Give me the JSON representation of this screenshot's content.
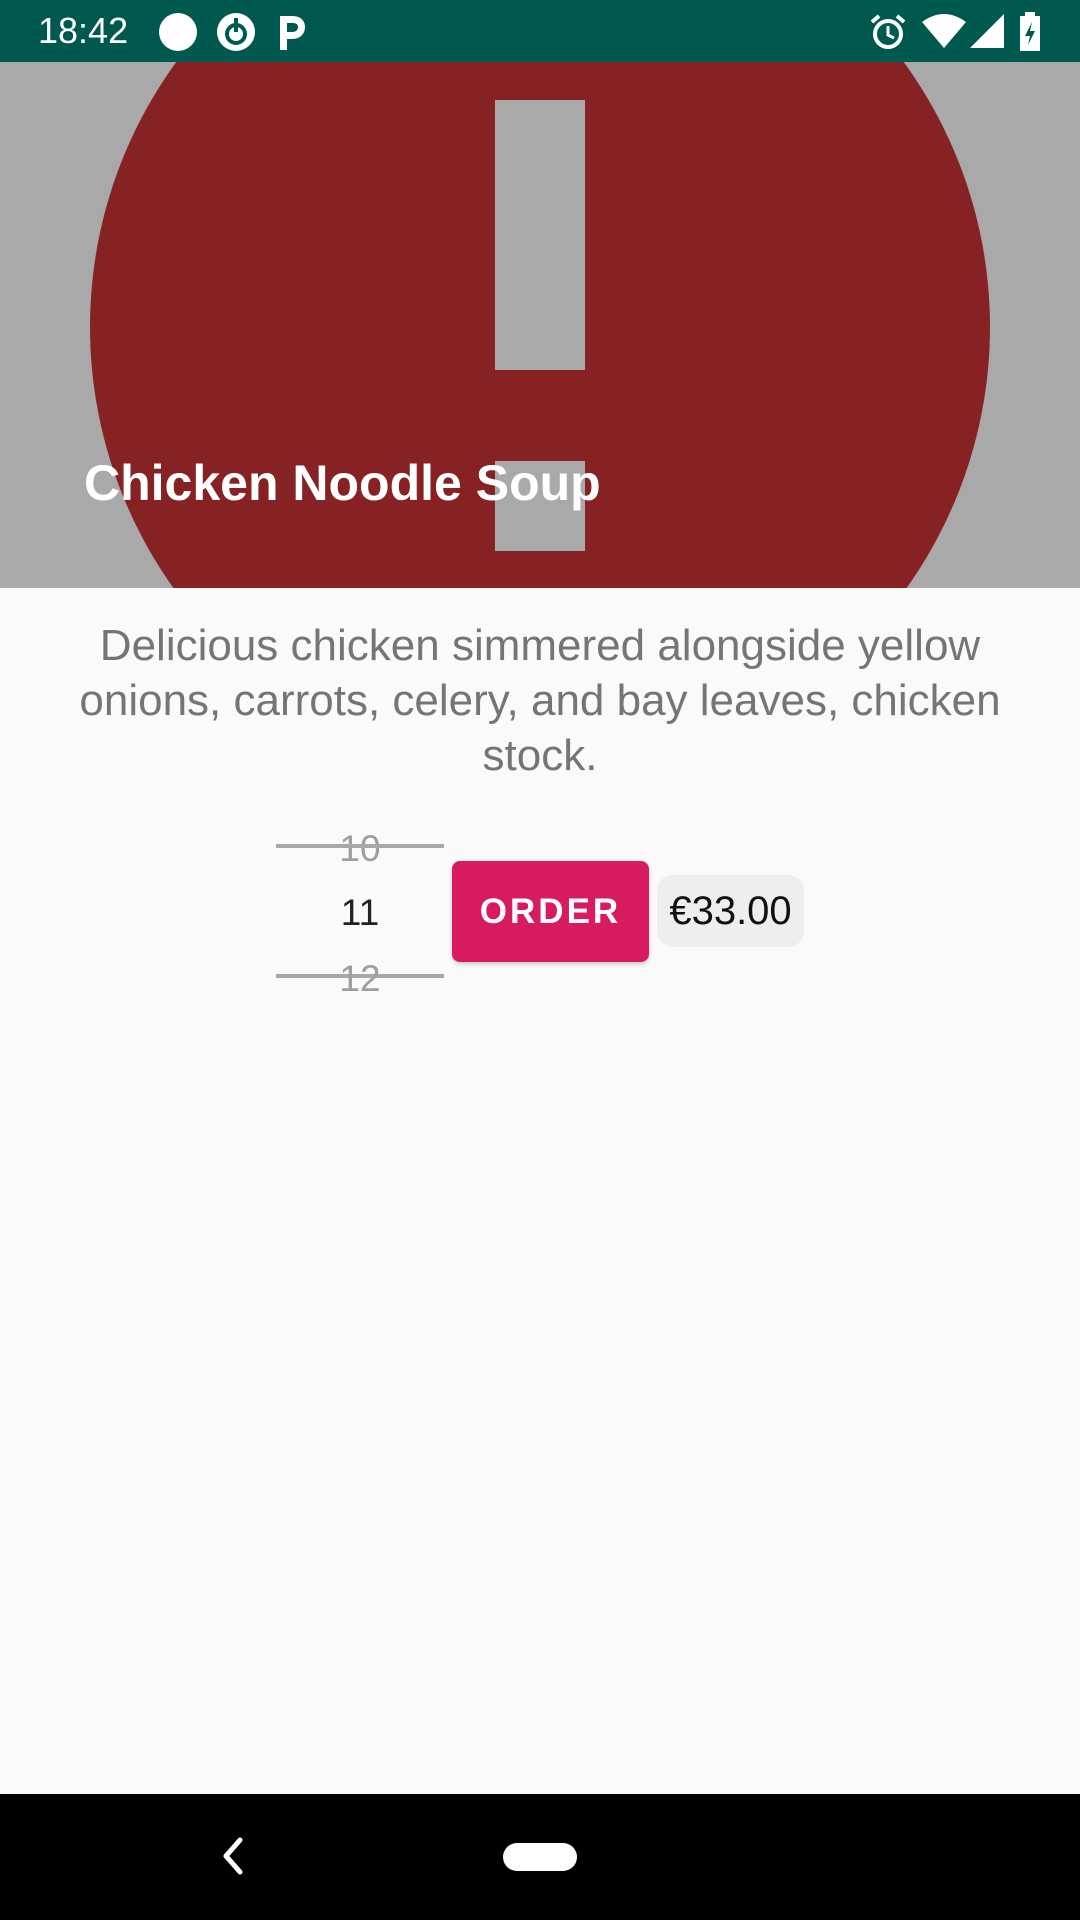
{
  "status_bar": {
    "time": "18:42",
    "left_icons": [
      "circle-notification-icon",
      "sync-icon",
      "parking-icon"
    ],
    "right_icons": [
      "alarm-icon",
      "wifi-icon",
      "cell-signal-icon",
      "battery-icon"
    ],
    "background": "#00594f"
  },
  "hero": {
    "title": "Chicken Noodle Soup",
    "image_icon": "error-exclamation-icon",
    "image_color": "#862224",
    "background": "#a9a9a9"
  },
  "description": "Delicious chicken simmered alongside yellow onions, carrots, celery, and bay leaves, chicken stock.",
  "quantity_picker": {
    "previous": "10",
    "current": "11",
    "next": "12"
  },
  "order_button": {
    "label": "ORDER",
    "color": "#d81b60"
  },
  "price": "€33.00",
  "nav_bar": {
    "icons": [
      "back-icon",
      "home-pill-icon"
    ]
  }
}
